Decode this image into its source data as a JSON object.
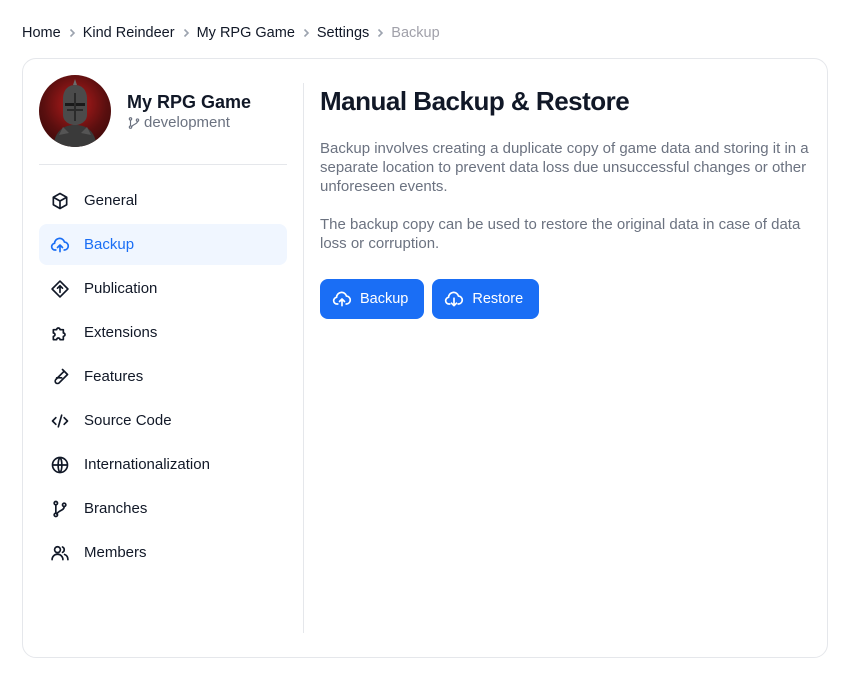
{
  "breadcrumb": {
    "items": [
      "Home",
      "Kind Reindeer",
      "My RPG Game",
      "Settings"
    ],
    "current": "Backup"
  },
  "project": {
    "name": "My RPG Game",
    "branch": "development"
  },
  "nav": {
    "items": [
      {
        "label": "General",
        "icon": "cube-icon"
      },
      {
        "label": "Backup",
        "icon": "cloud-upload-icon",
        "active": true
      },
      {
        "label": "Publication",
        "icon": "diamond-upload-icon"
      },
      {
        "label": "Extensions",
        "icon": "puzzle-icon"
      },
      {
        "label": "Features",
        "icon": "flask-icon"
      },
      {
        "label": "Source Code",
        "icon": "code-icon"
      },
      {
        "label": "Internationalization",
        "icon": "globe-icon"
      },
      {
        "label": "Branches",
        "icon": "git-branch-icon"
      },
      {
        "label": "Members",
        "icon": "users-icon"
      }
    ]
  },
  "main": {
    "title": "Manual Backup & Restore",
    "paragraphs": [
      "Backup involves creating a duplicate copy of game data and storing it in a separate location to prevent data loss due unsuccessful changes or other unforeseen events.",
      "The backup copy can be used to restore the original data in case of data loss or corruption."
    ],
    "backup_label": "Backup",
    "restore_label": "Restore"
  },
  "colors": {
    "accent": "#1a6ef5",
    "active_bg": "#f0f6ff",
    "muted_text": "#6b7280"
  }
}
